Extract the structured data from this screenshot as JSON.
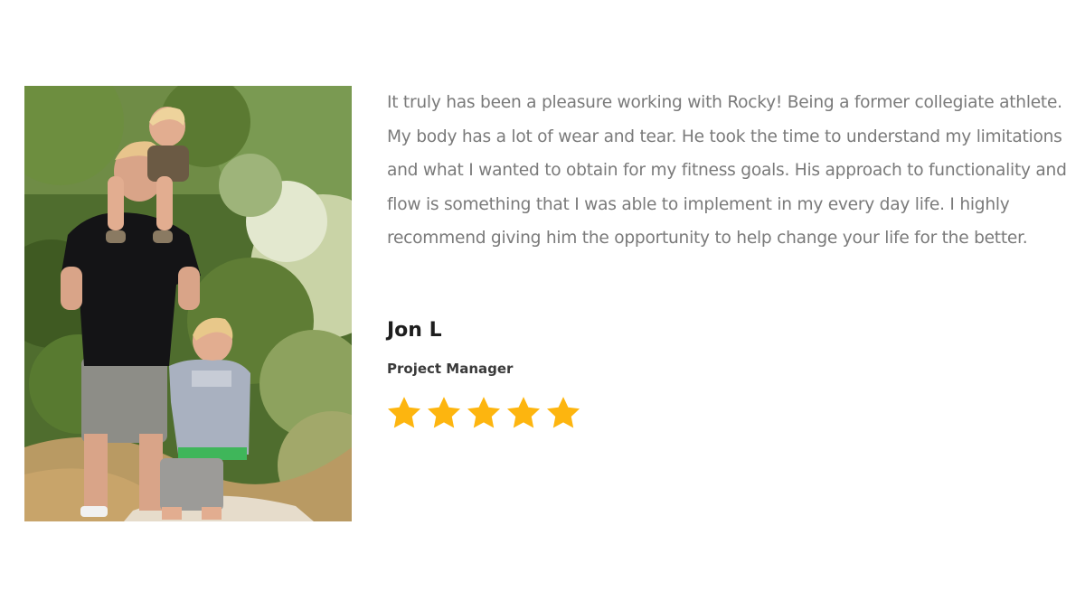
{
  "testimonial": {
    "photo_icon": "photo-man-with-two-children-on-forest-trail",
    "quote": "It truly has been a pleasure working with Rocky! Being a former collegiate athlete. My body has a lot of wear and tear. He took the time to understand my limitations and what I wanted to obtain for my fitness goals. His approach to functionality and flow is something that I was able to implement in my every day life. I highly recommend giving him the opportunity to help change your life for the better.",
    "name": "Jon L",
    "role": "Project Manager",
    "rating": 5,
    "rating_max": 5,
    "star_icon": "star-icon",
    "colors": {
      "star": "#FDB50F",
      "quote_text": "#7A7A7A",
      "name_text": "#1E1E1E",
      "background": "#FFFFFF"
    }
  }
}
